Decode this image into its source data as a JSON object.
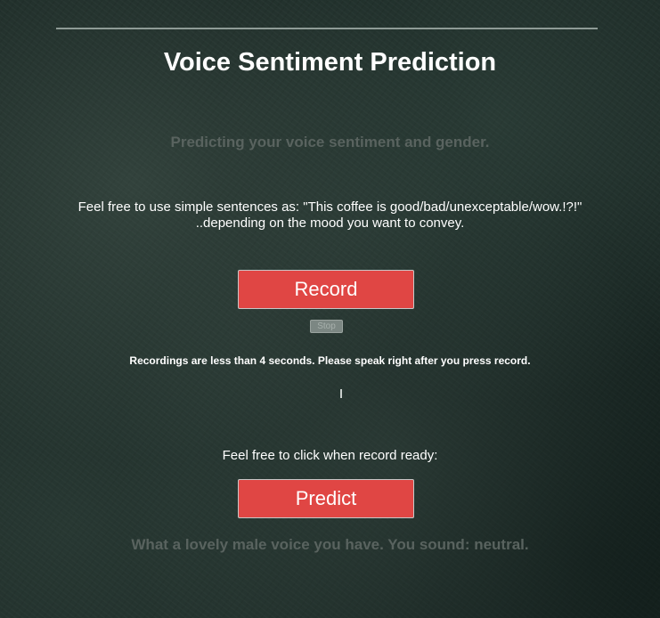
{
  "header": {
    "title": "Voice Sentiment Prediction",
    "subtitle": "Predicting your voice sentiment and gender."
  },
  "instructions": {
    "line1": "Feel free to use simple sentences as: \"This coffee is good/bad/unexceptable/wow.!?!\"",
    "line2": "..depending on the mood you want to convey."
  },
  "recording": {
    "record_label": "Record",
    "stop_label": "Stop",
    "note": "Recordings are less than 4 seconds. Please speak right after you press record."
  },
  "prediction": {
    "prompt": "Feel free to click when record ready:",
    "predict_label": "Predict",
    "result": "What a lovely male voice you have. You sound: neutral."
  },
  "colors": {
    "button_red": "#e04644",
    "muted_text": "#59635f",
    "background": "#1d2b27"
  }
}
